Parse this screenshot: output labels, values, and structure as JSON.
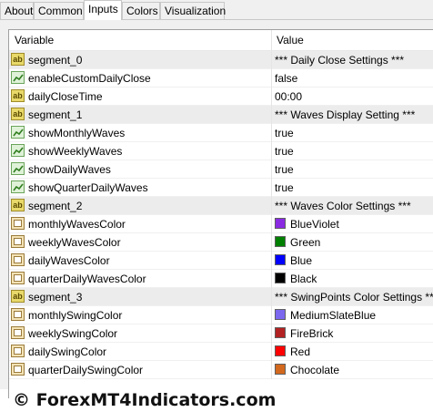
{
  "tabs": [
    {
      "label": "About"
    },
    {
      "label": "Common"
    },
    {
      "label": "Inputs"
    },
    {
      "label": "Colors"
    },
    {
      "label": "Visualization"
    }
  ],
  "active_tab": "Inputs",
  "table": {
    "col_variable": "Variable",
    "col_value": "Value",
    "rows": [
      {
        "icon": "ab-icon",
        "name": "segment_0",
        "value": "*** Daily Close Settings ***"
      },
      {
        "icon": "bool-icon",
        "name": "enableCustomDailyClose",
        "value": "false"
      },
      {
        "icon": "ab-icon",
        "name": "dailyCloseTime",
        "value": "00:00"
      },
      {
        "icon": "ab-icon",
        "name": "segment_1",
        "value": "*** Waves Display Setting ***"
      },
      {
        "icon": "bool-icon",
        "name": "showMonthlyWaves",
        "value": "true"
      },
      {
        "icon": "bool-icon",
        "name": "showWeeklyWaves",
        "value": "true"
      },
      {
        "icon": "bool-icon",
        "name": "showDailyWaves",
        "value": "true"
      },
      {
        "icon": "bool-icon",
        "name": "showQuarterDailyWaves",
        "value": "true"
      },
      {
        "icon": "ab-icon",
        "name": "segment_2",
        "value": "*** Waves Color Settings ***"
      },
      {
        "icon": "color-icon",
        "name": "monthlyWavesColor",
        "value": "BlueViolet",
        "color": "#8a2be2"
      },
      {
        "icon": "color-icon",
        "name": "weeklyWavesColor",
        "value": "Green",
        "color": "#008000"
      },
      {
        "icon": "color-icon",
        "name": "dailyWavesColor",
        "value": "Blue",
        "color": "#0000ff"
      },
      {
        "icon": "color-icon",
        "name": "quarterDailyWavesColor",
        "value": "Black",
        "color": "#000000"
      },
      {
        "icon": "ab-icon",
        "name": "segment_3",
        "value": "*** SwingPoints Color Settings ***"
      },
      {
        "icon": "color-icon",
        "name": "monthlySwingColor",
        "value": "MediumSlateBlue",
        "color": "#7b68ee"
      },
      {
        "icon": "color-icon",
        "name": "weeklySwingColor",
        "value": "FireBrick",
        "color": "#b22222"
      },
      {
        "icon": "color-icon",
        "name": "dailySwingColor",
        "value": "Red",
        "color": "#ff0000"
      },
      {
        "icon": "color-icon",
        "name": "quarterDailySwingColor",
        "value": "Chocolate",
        "color": "#d2691e"
      }
    ]
  },
  "watermark": "© ForexMT4Indicators.com"
}
